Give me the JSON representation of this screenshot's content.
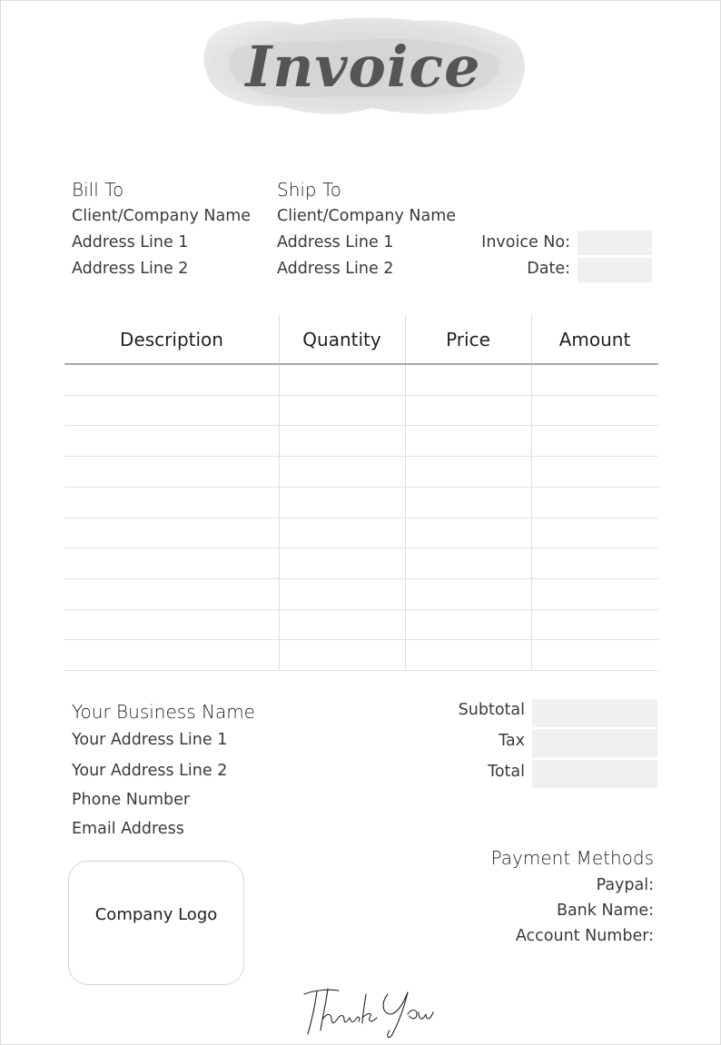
{
  "header": {
    "title": "Invoice"
  },
  "bill_to": {
    "heading": "Bill To",
    "name": "Client/Company Name",
    "address_line_1": "Address Line 1",
    "address_line_2": "Address Line 2"
  },
  "ship_to": {
    "heading": "Ship To",
    "name": "Client/Company Name",
    "address_line_1": "Address Line 1",
    "address_line_2": "Address Line 2"
  },
  "meta": {
    "invoice_no_label": "Invoice No:",
    "invoice_no_value": "",
    "date_label": "Date:",
    "date_value": ""
  },
  "table": {
    "columns": [
      "Description",
      "Quantity",
      "Price",
      "Amount"
    ],
    "rows": [
      [
        "",
        "",
        "",
        ""
      ],
      [
        "",
        "",
        "",
        ""
      ],
      [
        "",
        "",
        "",
        ""
      ],
      [
        "",
        "",
        "",
        ""
      ],
      [
        "",
        "",
        "",
        ""
      ],
      [
        "",
        "",
        "",
        ""
      ],
      [
        "",
        "",
        "",
        ""
      ],
      [
        "",
        "",
        "",
        ""
      ],
      [
        "",
        "",
        "",
        ""
      ],
      [
        "",
        "",
        "",
        ""
      ]
    ]
  },
  "business": {
    "name": "Your Business Name",
    "address_line_1": "Your Address Line 1",
    "address_line_2": "Your Address Line 2",
    "phone": "Phone Number",
    "email": "Email Address"
  },
  "totals": {
    "subtotal_label": "Subtotal",
    "subtotal_value": "",
    "tax_label": "Tax",
    "tax_value": "",
    "total_label": "Total",
    "total_value": ""
  },
  "payment": {
    "heading": "Payment Methods",
    "paypal_label": "Paypal:",
    "bank_label": "Bank Name:",
    "account_label": "Account Number:"
  },
  "logo": {
    "placeholder": "Company Logo"
  },
  "footer": {
    "signature": "Thank You"
  },
  "colors": {
    "field_fill": "#f0f0f0",
    "title": "#555555",
    "splash": "#d8d8d8"
  }
}
